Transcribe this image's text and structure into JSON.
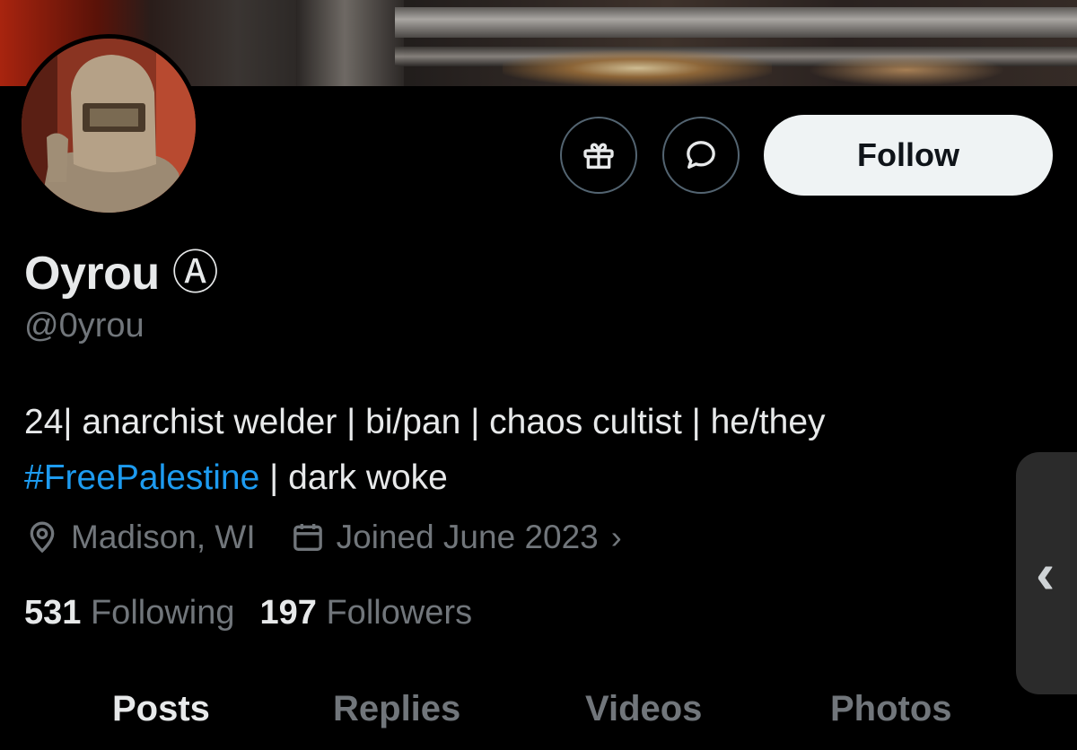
{
  "profile": {
    "name": "Oyrou",
    "badge": "Ⓐ",
    "handle": "@0yrou",
    "bio_line1": "24| anarchist welder | bi/pan | chaos cultist | he/they",
    "bio_hashtag": "#FreePalestine",
    "bio_rest": " | dark woke",
    "location": "Madison, WI",
    "joined": "Joined June 2023",
    "joined_chevron": "›",
    "following_count": "531",
    "following_label": "Following",
    "followers_count": "197",
    "followers_label": "Followers"
  },
  "actions": {
    "follow_label": "Follow"
  },
  "tabs": [
    {
      "label": "Posts",
      "active": true
    },
    {
      "label": "Replies",
      "active": false
    },
    {
      "label": "Videos",
      "active": false
    },
    {
      "label": "Photos",
      "active": false
    }
  ],
  "side_handle": {
    "glyph": "‹"
  },
  "colors": {
    "background": "#000000",
    "text_primary": "#e7e9ea",
    "text_secondary": "#71767b",
    "link": "#1d9bf0",
    "follow_bg": "#eff3f4"
  },
  "icons": [
    "gift-icon",
    "message-icon",
    "location-pin-icon",
    "calendar-icon"
  ]
}
